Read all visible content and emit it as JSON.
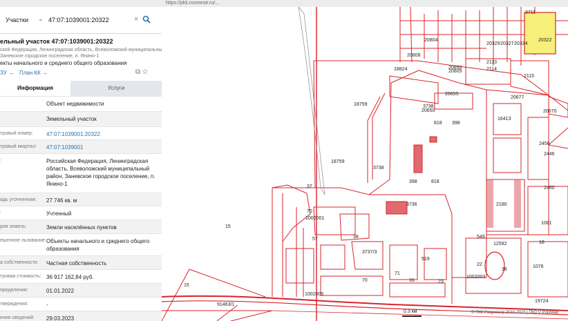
{
  "browser": {
    "url_fragment": "https://pkk.rosreestr.ru/..."
  },
  "search": {
    "type_label": "Участки",
    "value": "47:07:1039001:20322"
  },
  "parcel": {
    "title": "ельный участок 47:07:1039001:20322",
    "address_lines": [
      "ской Федерация, Ленинградская область, Всеволожский муниципальный",
      "Заневское городское поселение, п. Янино-1"
    ],
    "purpose": "екты начального и среднего общего образования",
    "link_zu": "ЗУ →",
    "link_plan": "План КК →"
  },
  "tabs": {
    "info": "Информация",
    "services": "Услуги"
  },
  "rows": [
    {
      "label": "",
      "value": "Объект недвижимости"
    },
    {
      "label": "",
      "value": "Земельный участок"
    },
    {
      "label": "тровый номер:",
      "value": "47:07:1039001:20322"
    },
    {
      "label": "тровый квартал:",
      "value": "47:07:1039001"
    },
    {
      "label": ":",
      "value": "Российская Федерация, Ленинградская область, Всеволожский муниципальный район, Заневское городское поселение, п. Янино-1"
    },
    {
      "label": "адь уточненная:",
      "value": "27 746 кв. м"
    },
    {
      "label": ":",
      "value": "Учтенный"
    },
    {
      "label": "рия земель:",
      "value": "Земли населённых пунктов"
    },
    {
      "label": "ешенное льзование:",
      "value": "Объекты начального и среднего общего образования"
    },
    {
      "label": "а собственности:",
      "value": "Частная собственность"
    },
    {
      "label": "тровая стоимость:",
      "value": "36 917 162,84 руб."
    },
    {
      "label": "пределения:",
      "value": "01.01.2022"
    },
    {
      "label": "тверждения:",
      "value": "-"
    },
    {
      "label": "ения сведений:",
      "value": "29.03.2023"
    }
  ],
  "map": {
    "parcel_labels": [
      "20322",
      "3711",
      "20804",
      "20329",
      "20327",
      "20334",
      "20808",
      "20850",
      "20605",
      "2113",
      "2114",
      "2115",
      "18824",
      "20655",
      "20677",
      "20670",
      "18759",
      "3738",
      "20650",
      "818",
      "398",
      "16413",
      "2456",
      "2446",
      "2460",
      "18759",
      "3738",
      "37",
      "398",
      "818",
      "2180",
      "1081",
      "3736",
      "12592",
      "549",
      "18",
      "70",
      "1002001",
      "38",
      "57",
      "3737/3",
      "519",
      "22",
      "38",
      "1076",
      "1002003",
      "23",
      "70",
      "71",
      "15",
      "15",
      "16",
      "19724",
      "91463/1",
      "1002005"
    ],
    "highlight_color": "#f6f07a",
    "line_color": "#d8232a",
    "scale_label": "0.3 км",
    "attribution": "© ПКК Росреестр 2010-2023 | ГКО © PolyMap"
  }
}
